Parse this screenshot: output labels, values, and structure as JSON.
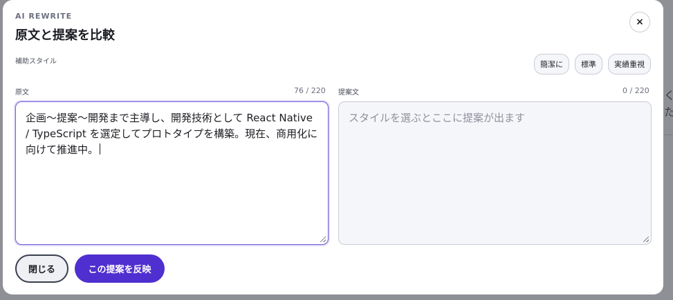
{
  "modal": {
    "eyebrow": "AI REWRITE",
    "title": "原文と提案を比較",
    "close_glyph": "×"
  },
  "style_section": {
    "label": "補助スタイル",
    "options": [
      {
        "label": "簡潔に"
      },
      {
        "label": "標準"
      },
      {
        "label": "実績重視"
      }
    ]
  },
  "original": {
    "label": "原文",
    "count": "76 / 220",
    "value": "企画〜提案〜開発まで主導し、開発技術として React Native / TypeScript を選定してプロトタイプを構築。現在、商用化に向けて推進中。"
  },
  "suggestion": {
    "label": "提案文",
    "count": "0 / 220",
    "placeholder": "スタイルを選ぶとここに提案が出ます"
  },
  "actions": {
    "close_label": "閉じる",
    "apply_label": "この提案を反映"
  },
  "colors": {
    "accent": "#4f2fcf",
    "focus_border": "#6e60d9",
    "overlay": "#8f9096"
  }
}
